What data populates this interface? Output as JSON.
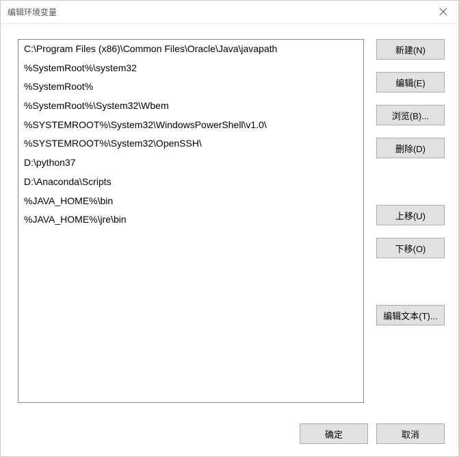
{
  "title": "编辑环境变量",
  "list_items": [
    "C:\\Program Files (x86)\\Common Files\\Oracle\\Java\\javapath",
    "%SystemRoot%\\system32",
    "%SystemRoot%",
    "%SystemRoot%\\System32\\Wbem",
    "%SYSTEMROOT%\\System32\\WindowsPowerShell\\v1.0\\",
    "%SYSTEMROOT%\\System32\\OpenSSH\\",
    "D:\\python37",
    "D:\\Anaconda\\Scripts",
    "%JAVA_HOME%\\bin",
    "%JAVA_HOME%\\jre\\bin"
  ],
  "buttons": {
    "new": "新建(N)",
    "edit": "编辑(E)",
    "browse": "浏览(B)...",
    "delete": "删除(D)",
    "move_up": "上移(U)",
    "move_down": "下移(O)",
    "edit_text": "编辑文本(T)...",
    "ok": "确定",
    "cancel": "取消"
  }
}
